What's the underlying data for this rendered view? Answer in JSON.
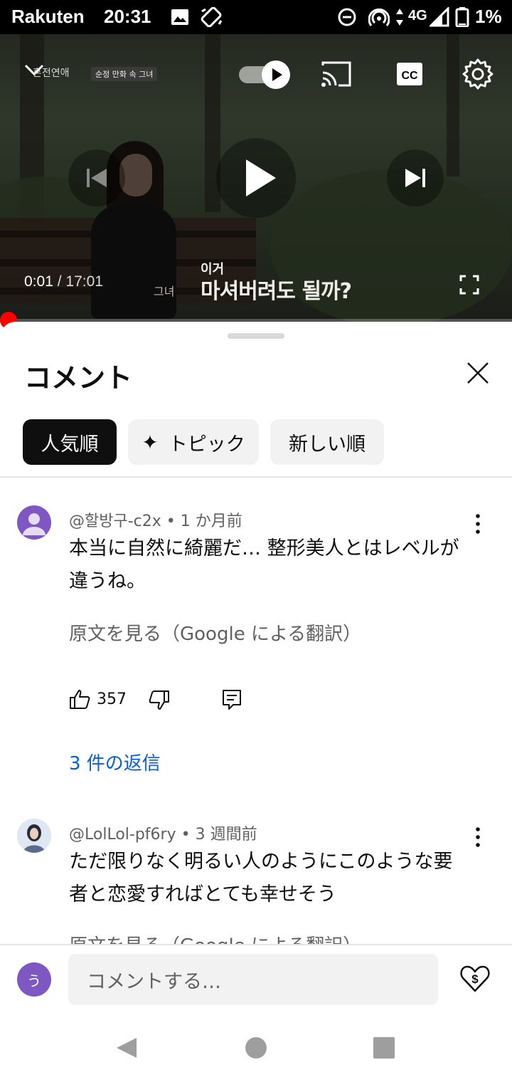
{
  "status_bar": {
    "carrier": "Rakuten",
    "time": "20:31",
    "network": "4G",
    "battery": "1%"
  },
  "video": {
    "channel_logo_text": "혼전연애",
    "badge_text": "순정 만화 속 그녀",
    "elapsed": "0:01",
    "separator": "/",
    "duration": "17:01",
    "subtitle_small": "이거",
    "subtitle_tag": "그녀",
    "subtitle_main": "마셔버려도 될까?",
    "progress_fraction": 0.001
  },
  "comments_panel": {
    "title": "コメント",
    "chips": [
      {
        "label": "人気順",
        "selected": true
      },
      {
        "label": "トピック",
        "selected": false,
        "icon": "sparkle-icon"
      },
      {
        "label": "新しい順",
        "selected": false
      }
    ],
    "comments": [
      {
        "author": "@할방구-c2x",
        "age": "1 か月前",
        "text_line1": "本当に自然に綺麗だ…  整形美人とはレベルが",
        "text_line2": "違うね。",
        "translate_link": "原文を見る（Google による翻訳）",
        "likes": "357",
        "replies": "3 件の返信"
      },
      {
        "author": "@LolLol-pf6ry",
        "age": "3 週間前",
        "text_line1": "ただ限りなく明るい人のようにこのような要",
        "text_line2": "者と恋愛すればとても幸せそう",
        "translate_link": "原文を見る（Google による翻訳）"
      }
    ],
    "meta_separator": "•",
    "composer": {
      "avatar_letter": "う",
      "placeholder": "コメントする…"
    }
  },
  "colors": {
    "accent_blue": "#065fd4",
    "progress_red": "#ff0000",
    "avatar_purple": "#7e57c2"
  }
}
